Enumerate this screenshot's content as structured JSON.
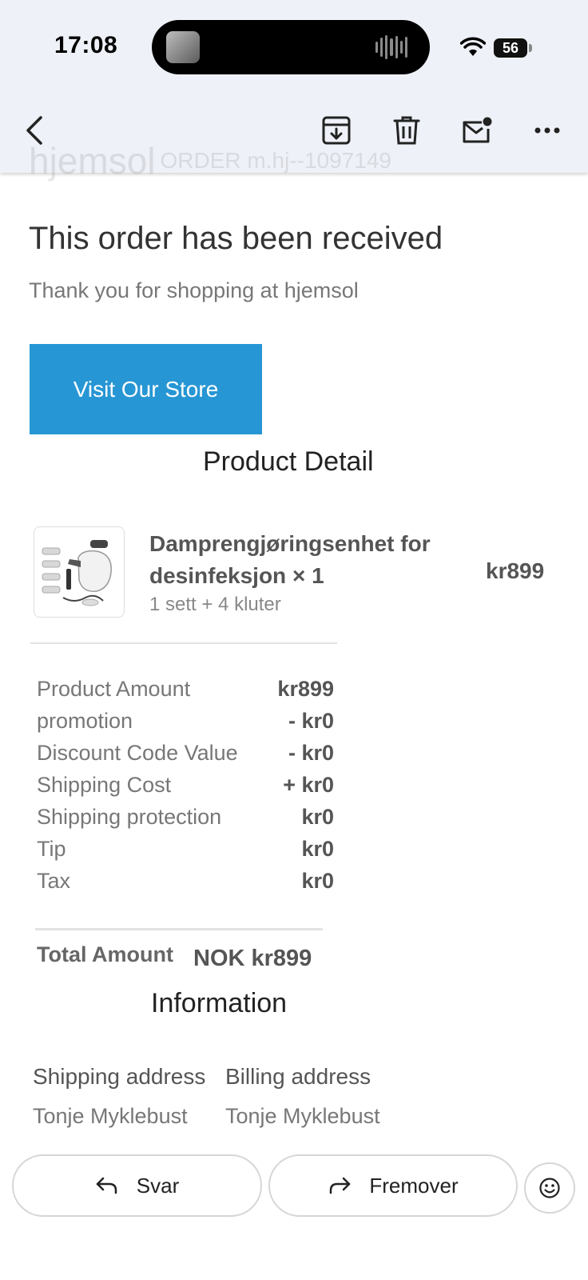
{
  "status_bar": {
    "time": "17:08",
    "battery": "56"
  },
  "email_header": {
    "brand": "hjemsol",
    "order_ref": "ORDER m.hj--1097149"
  },
  "content": {
    "heading": "This order has been received",
    "subheading": "Thank you for shopping at hjemsol",
    "store_button": "Visit Our Store",
    "product_section_title": "Product Detail",
    "product": {
      "name": "Damprengjøringsenhet for desinfeksjon × 1",
      "variant": "1 sett + 4 kluter",
      "price": "kr899"
    },
    "summary": [
      {
        "label": "Product Amount",
        "value": "kr899"
      },
      {
        "label": "promotion",
        "value": "- kr0"
      },
      {
        "label": "Discount Code Value",
        "value": "- kr0"
      },
      {
        "label": "Shipping Cost",
        "value": "+ kr0"
      },
      {
        "label": "Shipping protection",
        "value": "kr0"
      },
      {
        "label": "Tip",
        "value": "kr0"
      },
      {
        "label": "Tax",
        "value": "kr0"
      }
    ],
    "total": {
      "label": "Total Amount",
      "value": "NOK kr899"
    },
    "information_title": "Information",
    "shipping": {
      "heading": "Shipping address",
      "name": "Tonje Myklebust"
    },
    "billing": {
      "heading": "Billing address",
      "name": "Tonje Myklebust"
    }
  },
  "actions": {
    "reply": "Svar",
    "forward": "Fremover"
  },
  "colors": {
    "accent": "#2796d4",
    "header_bg": "#eef1f7"
  }
}
